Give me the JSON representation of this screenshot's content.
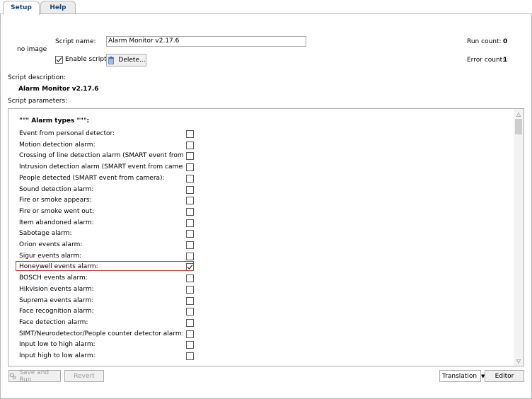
{
  "tabs": [
    {
      "label": "Setup",
      "active": true
    },
    {
      "label": "Help",
      "active": false
    }
  ],
  "header": {
    "image_placeholder": "no image",
    "script_name_label": "Script name:",
    "script_name_value": "Alarm Monitor v2.17.6",
    "enable_script_label": "Enable script",
    "enable_script_checked": true,
    "delete_label": "Delete...",
    "run_count_label": "Run count:",
    "run_count_value": "0",
    "error_count_label": "Error count:",
    "error_count_value": "1"
  },
  "description": {
    "label": "Script description:",
    "text": "Alarm Monitor v2.17.6"
  },
  "parameters": {
    "label": "Script parameters:",
    "section_header": "\"\"\" Alarm types \"\"\":",
    "items": [
      {
        "label": "Event from personal detector:",
        "checked": false
      },
      {
        "label": "Motion detection alarm:",
        "checked": false
      },
      {
        "label": "Crossing of line detection alarm (SMART event from camera):",
        "checked": false
      },
      {
        "label": "Intrusion detection alarm (SMART event from camera):",
        "checked": false
      },
      {
        "label": "People detected (SMART event from camera):",
        "checked": false
      },
      {
        "label": "Sound detection alarm:",
        "checked": false
      },
      {
        "label": "Fire or smoke appears:",
        "checked": false
      },
      {
        "label": "Fire or smoke went out:",
        "checked": false
      },
      {
        "label": "Item abandoned alarm:",
        "checked": false
      },
      {
        "label": "Sabotage alarm:",
        "checked": false
      },
      {
        "label": "Orion events alarm:",
        "checked": false
      },
      {
        "label": "Sigur events alarm:",
        "checked": false
      },
      {
        "label": "Honeywell events alarm:",
        "checked": true,
        "highlighted": true
      },
      {
        "label": "BOSCH events alarm:",
        "checked": false
      },
      {
        "label": "Hikvision events alarm:",
        "checked": false
      },
      {
        "label": "Suprema events alarm:",
        "checked": false
      },
      {
        "label": "Face recognition alarm:",
        "checked": false
      },
      {
        "label": "Face detection alarm:",
        "checked": false
      },
      {
        "label": "SIMT/Neurodetector/People counter detector alarm:",
        "checked": false
      },
      {
        "label": "Input low to high alarm:",
        "checked": false
      },
      {
        "label": "Input high to low alarm:",
        "checked": false
      }
    ]
  },
  "footer": {
    "save_and_run_label": "Save and Run",
    "revert_label": "Revert",
    "translation_label": "Translation",
    "editor_label": "Editor"
  },
  "colors": {
    "tab_text": "#1f3f73",
    "highlight_border": "#c0392b",
    "delete_icon": "#3b6fb5"
  }
}
